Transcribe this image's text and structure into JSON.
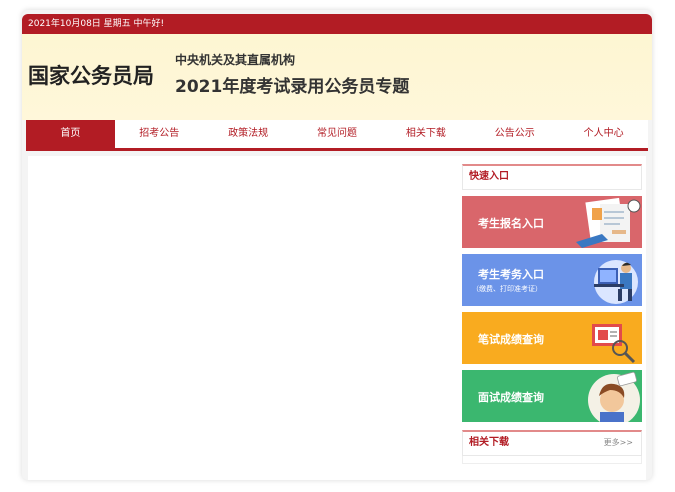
{
  "topbar": {
    "date_text": "2021年10月08日 星期五 中午好!"
  },
  "header": {
    "logo": "国家公务员局",
    "subtitle_line1": "中央机关及其直属机构",
    "subtitle_line2": "2021年度考试录用公务员专题"
  },
  "nav": {
    "items": [
      {
        "label": "首页"
      },
      {
        "label": "招考公告"
      },
      {
        "label": "政策法规"
      },
      {
        "label": "常见问题"
      },
      {
        "label": "相关下载"
      },
      {
        "label": "公告公示"
      },
      {
        "label": "个人中心"
      }
    ],
    "active_index": 0
  },
  "sidebar": {
    "quick_title": "快速入口",
    "cards": [
      {
        "label": "考生报名入口",
        "sublabel": ""
      },
      {
        "label": "考生考务入口",
        "sublabel": "（缴费、打印准考证）"
      },
      {
        "label": "笔试成绩查询",
        "sublabel": ""
      },
      {
        "label": "面试成绩查询",
        "sublabel": ""
      }
    ],
    "downloads_title": "相关下载",
    "more_label": "更多>>"
  },
  "colors": {
    "brand_red": "#b21c24",
    "header_bg": "#fdf6d2",
    "card_red": "#d9666b",
    "card_blue": "#6b93e8",
    "card_orange": "#f9ab1f",
    "card_green": "#3bb76f"
  },
  "icons": [
    "register-illustration-icon",
    "computer-user-icon",
    "screen-magnifier-icon",
    "interview-person-icon"
  ]
}
